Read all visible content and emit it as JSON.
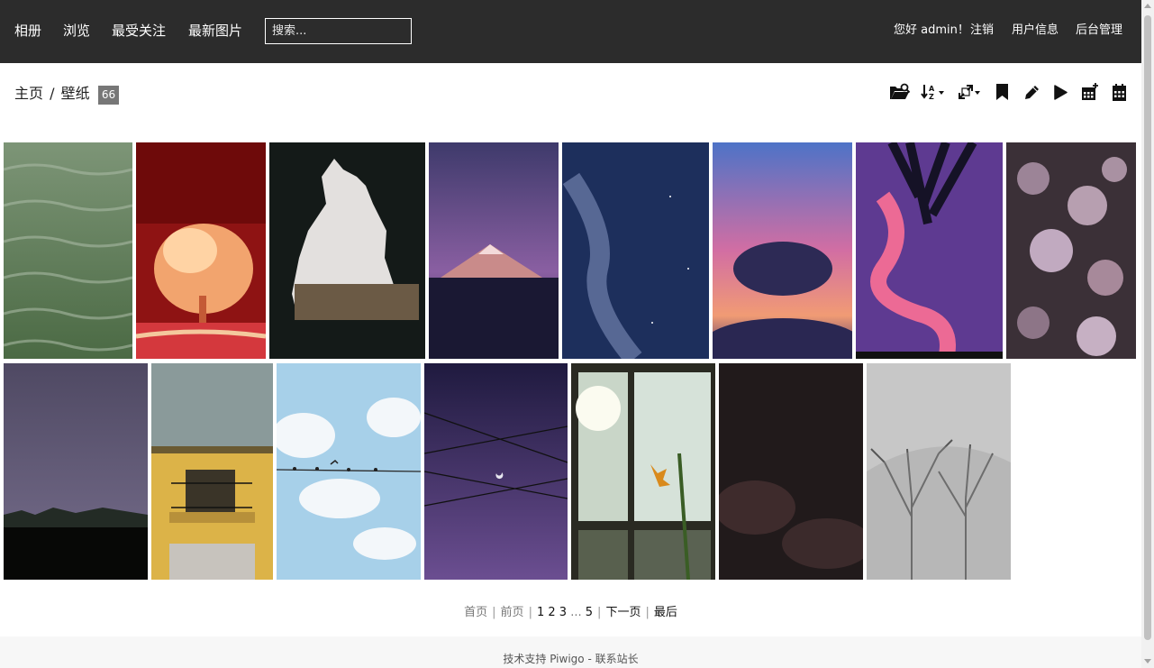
{
  "nav": {
    "albums": "相册",
    "browse": "浏览",
    "most_visited": "最受关注",
    "recent_photos": "最新图片",
    "search_placeholder": "搜索...",
    "greeting": "您好 admin！",
    "logout": "注销",
    "profile": "用户信息",
    "admin": "后台管理"
  },
  "breadcrumb": {
    "home": "主页",
    "separator": "/",
    "album": "壁纸",
    "count": "66"
  },
  "toolbar": {
    "icons": [
      "album-search-icon",
      "sort-order-icon",
      "photo-size-icon",
      "favorite-bookmark-icon",
      "edit-icon",
      "slideshow-play-icon",
      "calendar-posted-icon",
      "calendar-created-icon"
    ]
  },
  "thumbnails": [
    {
      "subject": "green water waves"
    },
    {
      "subject": "red infrared tree"
    },
    {
      "subject": "cave opening landscape"
    },
    {
      "subject": "purple mountain peak"
    },
    {
      "subject": "blue night sky clouds"
    },
    {
      "subject": "pink sunset cloud"
    },
    {
      "subject": "palm and pink cloud"
    },
    {
      "subject": "lilac flowers"
    },
    {
      "subject": "foggy purple hills"
    },
    {
      "subject": "yellow building balcony"
    },
    {
      "subject": "birds on wire sky"
    },
    {
      "subject": "crescent moon power lines"
    },
    {
      "subject": "window with flower"
    },
    {
      "subject": "dark moon clouds"
    },
    {
      "subject": "bare winter trees"
    }
  ],
  "pagination": {
    "first": "首页",
    "prev": "前页",
    "p1": "1",
    "p2": "2",
    "p3": "3",
    "ellipsis": "...",
    "p5": "5",
    "next": "下一页",
    "last": "最后",
    "sep": "|"
  },
  "footer": {
    "powered_by": "技术支持",
    "piwigo": "Piwigo",
    "dash": "-",
    "contact": "联系站长"
  },
  "colors": {
    "topbar": "#2c2c2c",
    "badge": "#777777",
    "footer_bg": "#f7f7f7"
  }
}
